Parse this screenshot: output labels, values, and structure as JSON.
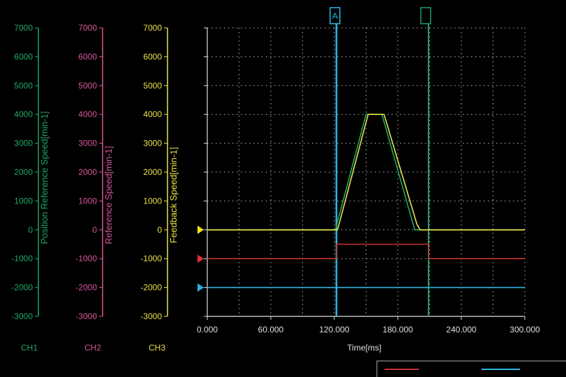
{
  "colors": {
    "background": "#000000",
    "ch1": "#1fa868",
    "ch2": "#d8579a",
    "ch3": "#e9e34a",
    "grid": "#bdbdbd",
    "cursor_a": "#2bb8e6",
    "cursor_b": "#1f9e6a",
    "trace_red": "#c8312f",
    "trace_blue": "#2bb8e6",
    "marker_yellow": "#f2e21a",
    "marker_red": "#e0303a",
    "marker_blue": "#22b4e8"
  },
  "channels": {
    "ch1": {
      "name": "CH1",
      "label": "Position Reference Speed[min-1]"
    },
    "ch2": {
      "name": "CH2",
      "label": "Reference Speed[min-1]"
    },
    "ch3": {
      "name": "CH3",
      "label": "Feedback Speed[min-1]"
    }
  },
  "cursors": {
    "a": {
      "label": "A",
      "time": 122
    },
    "b": {
      "label": "",
      "time": 209
    }
  },
  "chart_data": {
    "type": "line",
    "xlabel": "Time[ms]",
    "xlim": [
      0,
      300
    ],
    "xticks": [
      0,
      60,
      120,
      180,
      240,
      300
    ],
    "xtick_labels": [
      "0.000",
      "60.000",
      "120.000",
      "180.000",
      "240.000",
      "300.000"
    ],
    "ylim": [
      -3000,
      7000
    ],
    "yticks": [
      -3000,
      -2000,
      -1000,
      0,
      1000,
      2000,
      3000,
      4000,
      5000,
      6000,
      7000
    ],
    "grid": true,
    "series": [
      {
        "name": "Position Reference Speed[min-1]",
        "channel": "ch1",
        "color": "#1fa868",
        "x": [
          0,
          121,
          150,
          165,
          196,
          300
        ],
        "y": [
          0,
          0,
          4000,
          4000,
          0,
          0
        ]
      },
      {
        "name": "Feedback Speed[min-1]",
        "channel": "ch3",
        "color": "#e9e34a",
        "x": [
          0,
          123,
          126,
          152,
          167,
          198,
          201,
          300
        ],
        "y": [
          0,
          0,
          400,
          4000,
          4000,
          200,
          0,
          0
        ]
      },
      {
        "channel": "ch2",
        "color": "#c8312f",
        "x": [
          0,
          122,
          122,
          209,
          209,
          300
        ],
        "y": [
          -1000,
          -1000,
          -500,
          -500,
          -1000,
          -1000
        ]
      },
      {
        "color": "#2bb8e6",
        "x": [
          0,
          300
        ],
        "y": [
          -2000,
          -2000
        ]
      }
    ]
  }
}
